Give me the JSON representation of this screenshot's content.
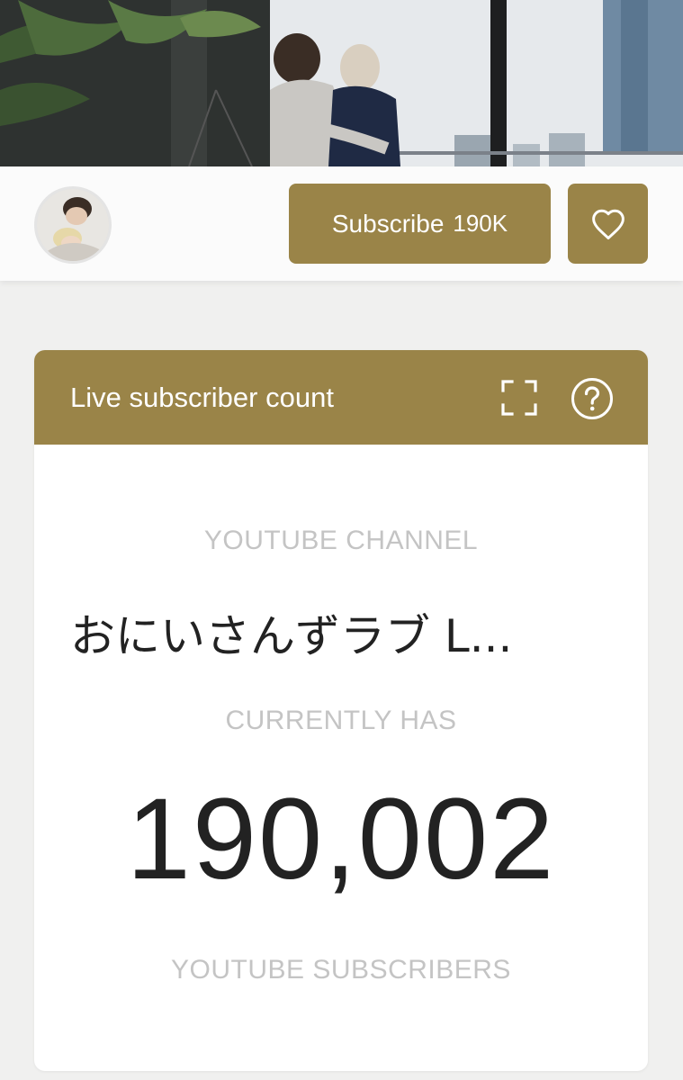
{
  "subscribe_button": {
    "label": "Subscribe",
    "count": "190K"
  },
  "card": {
    "title": "Live subscriber count",
    "channel_label": "YOUTUBE CHANNEL",
    "channel_name": "おにいさんずラブ L...",
    "currently_label": "CURRENTLY HAS",
    "subscriber_count": "190,002",
    "subscribers_label": "YOUTUBE SUBSCRIBERS"
  },
  "icons": {
    "heart": "heart-icon",
    "fullscreen": "fullscreen-icon",
    "help": "help-icon"
  },
  "colors": {
    "accent": "#9a8448",
    "page_background": "#f0f0ef",
    "muted_text": "#c4c4c4"
  }
}
